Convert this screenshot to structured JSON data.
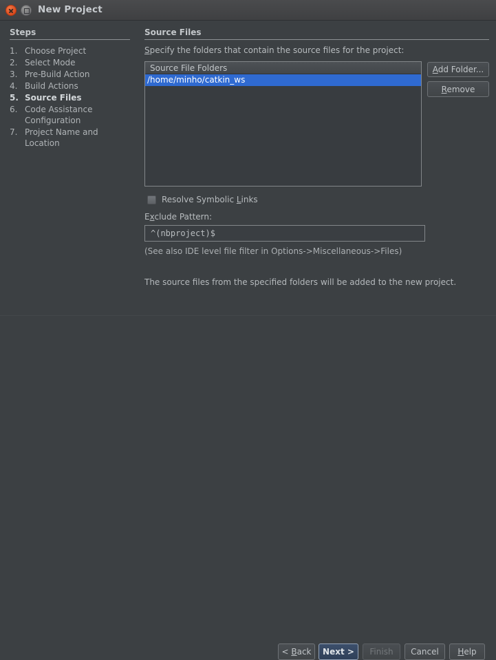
{
  "window": {
    "title": "New Project",
    "close_icon": "close-icon",
    "maximize_icon": "maximize-icon"
  },
  "steps_panel": {
    "header": "Steps",
    "items": [
      {
        "num": "1.",
        "label": "Choose Project",
        "current": false
      },
      {
        "num": "2.",
        "label": "Select Mode",
        "current": false
      },
      {
        "num": "3.",
        "label": "Pre-Build Action",
        "current": false
      },
      {
        "num": "4.",
        "label": "Build Actions",
        "current": false
      },
      {
        "num": "5.",
        "label": "Source Files",
        "current": true
      },
      {
        "num": "6.",
        "label": "Code Assistance Configuration",
        "current": false
      },
      {
        "num": "7.",
        "label": "Project Name and Location",
        "current": false
      }
    ]
  },
  "main": {
    "header": "Source Files",
    "specify_label_pre": "S",
    "specify_label_rest": "pecify the folders that contain the source files for the project:",
    "folders_list": {
      "column_header": "Source File Folders",
      "rows": [
        {
          "path": "/home/minho/catkin_ws",
          "selected": true
        }
      ]
    },
    "add_folder_pre": "A",
    "add_folder_rest": "dd Folder...",
    "remove_pre": "R",
    "remove_rest": "emove",
    "resolve_symlinks_label_pre": "Resolve Symbolic ",
    "resolve_symlinks_mnemonic": "L",
    "resolve_symlinks_label_post": "inks",
    "resolve_symlinks_checked": false,
    "exclude_pattern_pre": "E",
    "exclude_pattern_mnemonic": "x",
    "exclude_pattern_post": "clude Pattern:",
    "exclude_pattern_value": "^(nbproject)$",
    "filter_note": "(See also IDE level file filter in Options->Miscellaneous->Files)",
    "summary": "The source files from the specified folders will be added to the new project."
  },
  "footer": {
    "back_pre": "< ",
    "back_mnemonic": "B",
    "back_post": "ack",
    "next_label": "Next >",
    "finish_label": "Finish",
    "finish_disabled": true,
    "cancel_label": "Cancel",
    "help_mnemonic": "H",
    "help_post": "elp"
  },
  "colors": {
    "window_bg": "#3c4043",
    "selection_blue": "#2f6ad1",
    "default_button_blue": "#35476180",
    "close_button": "#db4c20",
    "text": "#b8bcbf"
  }
}
